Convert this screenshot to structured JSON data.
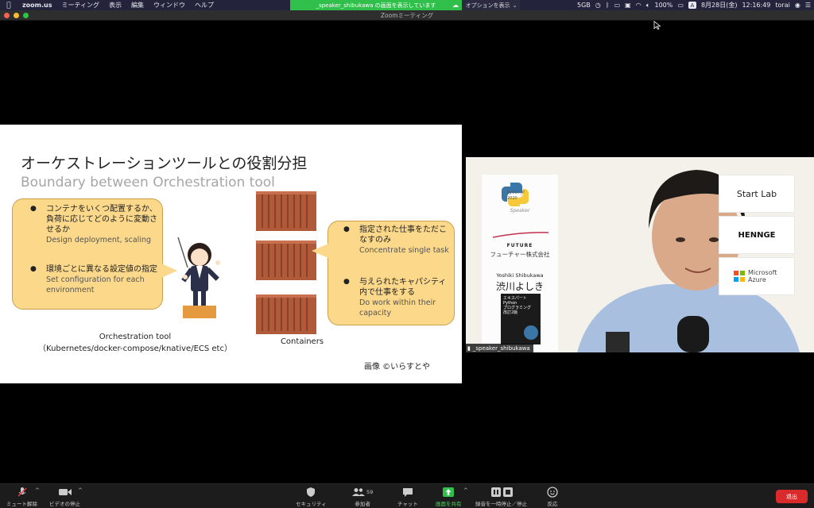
{
  "menubar": {
    "app_name": "zoom.us",
    "menus": [
      "ミーティング",
      "表示",
      "編集",
      "ウィンドウ",
      "ヘルプ"
    ],
    "share_banner": "_speaker_shibukawa の画面を表示しています",
    "options_button": "オプションを表示",
    "status": {
      "gb": "5GB",
      "battery": "100%",
      "input_method": "A",
      "date": "8月28日(金)",
      "time": "12:16:49",
      "user": "torai"
    }
  },
  "window": {
    "title": "Zoomミーティング"
  },
  "slide": {
    "title_ja": "オーケストレーションツールとの役割分担",
    "title_en": "Boundary between Orchestration tool",
    "left_bullets": [
      {
        "ja": "コンテナをいくつ配置するか、負荷に応じてどのように変動させるか",
        "en": "Design deployment, scaling"
      },
      {
        "ja": "環境ごとに異なる設定値の指定",
        "en": "Set configuration for each environment"
      }
    ],
    "right_bullets": [
      {
        "ja": "指定された仕事をただこなすのみ",
        "en": "Concentrate single task"
      },
      {
        "ja": "与えられたキャパシティ内で仕事をする",
        "en": "Do work within their capacity"
      }
    ],
    "orchestration_caption_line1": "Orchestration tool",
    "orchestration_caption_line2": "（Kubernetes/docker-compose/knative/ECS etc）",
    "containers_caption": "Containers",
    "credit": "画像 ©いらすとや"
  },
  "video": {
    "participant_name": "_speaker_shibukawa",
    "speaker_panel": {
      "pycon_line1": "PyCon JP",
      "pycon_line2": "2020",
      "role": "Speaker",
      "company_logo": "FUTURE",
      "company": "フューチャー株式会社",
      "name_en": "Yoshiki Shibukawa",
      "name_ja": "渋川よしき",
      "book_line1": "エキスパート",
      "book_line2": "Python",
      "book_line3": "プログラミング",
      "book_line4": "改訂2版"
    },
    "sponsors": [
      "Start Lab",
      "HENNGE",
      "Microsoft",
      "Azure"
    ]
  },
  "toolbar": {
    "mute": "ミュート解除",
    "video": "ビデオの停止",
    "security": "セキュリティ",
    "participants": "参加者",
    "participant_count": "59",
    "chat": "チャット",
    "share": "画面を共有",
    "record": "録音を一時停止／停止",
    "reactions": "反応",
    "leave": "退出"
  },
  "colors": {
    "bubble": "#fbd88a",
    "share_banner": "#2fbf4a",
    "leave": "#d92b2b",
    "container": "#b05a3a"
  }
}
